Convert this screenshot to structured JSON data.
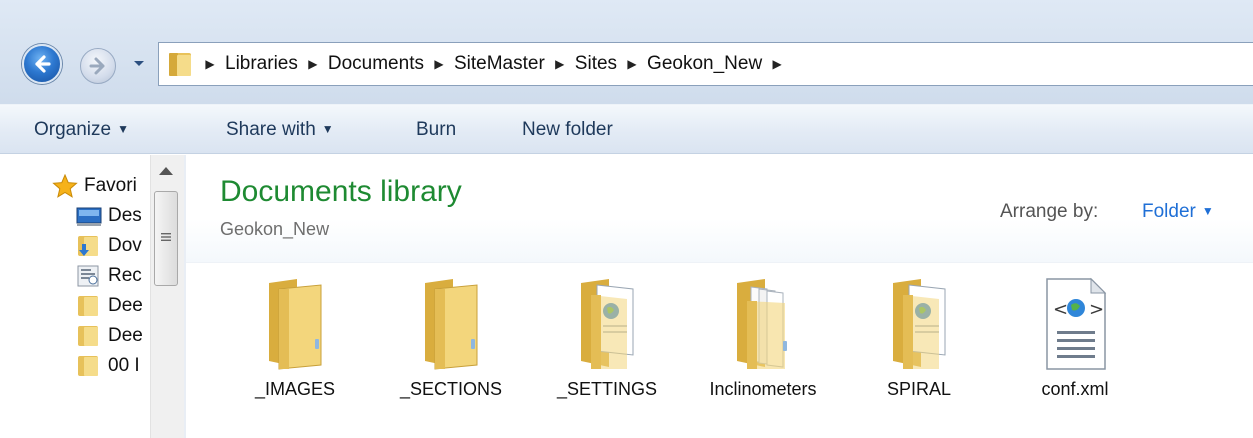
{
  "address_bar": {
    "breadcrumbs": [
      "Libraries",
      "Documents",
      "SiteMaster",
      "Sites",
      "Geokon_New"
    ]
  },
  "command_bar": {
    "organize": "Organize",
    "share_with": "Share with",
    "burn": "Burn",
    "new_folder": "New folder"
  },
  "nav_pane": {
    "items": [
      {
        "label": "Favori",
        "icon": "star-icon"
      },
      {
        "label": "Des",
        "icon": "desktop-icon"
      },
      {
        "label": "Dov",
        "icon": "downloads-icon"
      },
      {
        "label": "Rec",
        "icon": "recent-places-icon"
      },
      {
        "label": "Dee",
        "icon": "folder-icon"
      },
      {
        "label": "Dee",
        "icon": "folder-icon"
      },
      {
        "label": "00 I",
        "icon": "folder-icon"
      }
    ]
  },
  "library": {
    "title": "Documents library",
    "subtitle": "Geokon_New",
    "arrange_label": "Arrange by:",
    "arrange_value": "Folder"
  },
  "files": [
    {
      "name": "_IMAGES",
      "type": "folder"
    },
    {
      "name": "_SECTIONS",
      "type": "folder"
    },
    {
      "name": "_SETTINGS",
      "type": "folder-with-doc"
    },
    {
      "name": "Inclinometers",
      "type": "folder-with-files"
    },
    {
      "name": "SPIRAL",
      "type": "folder-with-doc"
    },
    {
      "name": "conf.xml",
      "type": "xml-file"
    }
  ],
  "colors": {
    "library_title": "#1e8a32",
    "arrange_value": "#1f6fd6",
    "command_text": "#1e395b"
  }
}
